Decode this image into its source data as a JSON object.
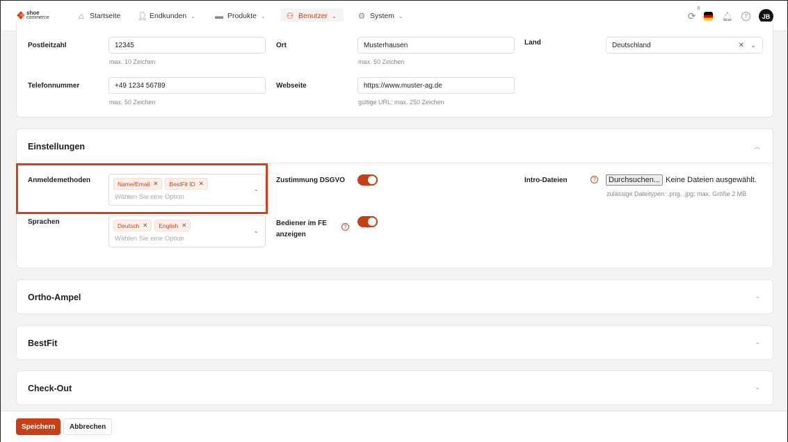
{
  "header": {
    "logo_top": "shoe",
    "logo_bottom": "commerce",
    "nav": [
      {
        "label": "Startseite",
        "icon": "home-icon"
      },
      {
        "label": "Endkunden",
        "icon": "user-icon"
      },
      {
        "label": "Produkte",
        "icon": "shoe-icon"
      },
      {
        "label": "Benutzer",
        "icon": "users-icon",
        "active": true
      },
      {
        "label": "System",
        "icon": "gear-icon"
      }
    ],
    "sync_count": "0",
    "avatar": "JB"
  },
  "address": {
    "postleitzahl": {
      "label": "Postleitzahl",
      "value": "12345",
      "hint": "max. 10 Zeichen"
    },
    "ort": {
      "label": "Ort",
      "value": "Musterhausen",
      "hint": "max. 50 Zeichen"
    },
    "land": {
      "label": "Land",
      "value": "Deutschland"
    },
    "telefon": {
      "label": "Telefonnummer",
      "value": "+49 1234 56789",
      "hint": "max. 50 Zeichen"
    },
    "webseite": {
      "label": "Webseite",
      "value": "https://www.muster-ag.de",
      "hint": "gültige URL; max. 250 Zeichen"
    }
  },
  "settings": {
    "title": "Einstellungen",
    "anmeldemethoden": {
      "label": "Anmeldemethoden",
      "tags": [
        "Name/Email",
        "BestFit ID"
      ],
      "placeholder": "Wählen Sie eine Option"
    },
    "sprachen": {
      "label": "Sprachen",
      "tags": [
        "Deutsch",
        "English"
      ],
      "placeholder": "Wählen Sie eine Option"
    },
    "dsgvo": {
      "label": "Zustimmung DSGVO",
      "on": true
    },
    "bediener": {
      "label1": "Bediener im FE",
      "label2": "anzeigen",
      "on": true
    },
    "intro": {
      "label": "Intro-Dateien",
      "button": "Durchsuchen...",
      "status": "Keine Dateien ausgewählt.",
      "hint": "zulässige Dateitypen: .png, .jpg; max. Größe 2 MB"
    }
  },
  "sections": [
    "Ortho-Ampel",
    "BestFit",
    "Check-Out"
  ],
  "footer": {
    "save": "Speichern",
    "cancel": "Abbrechen"
  },
  "colors": {
    "accent": "#d2421a"
  }
}
